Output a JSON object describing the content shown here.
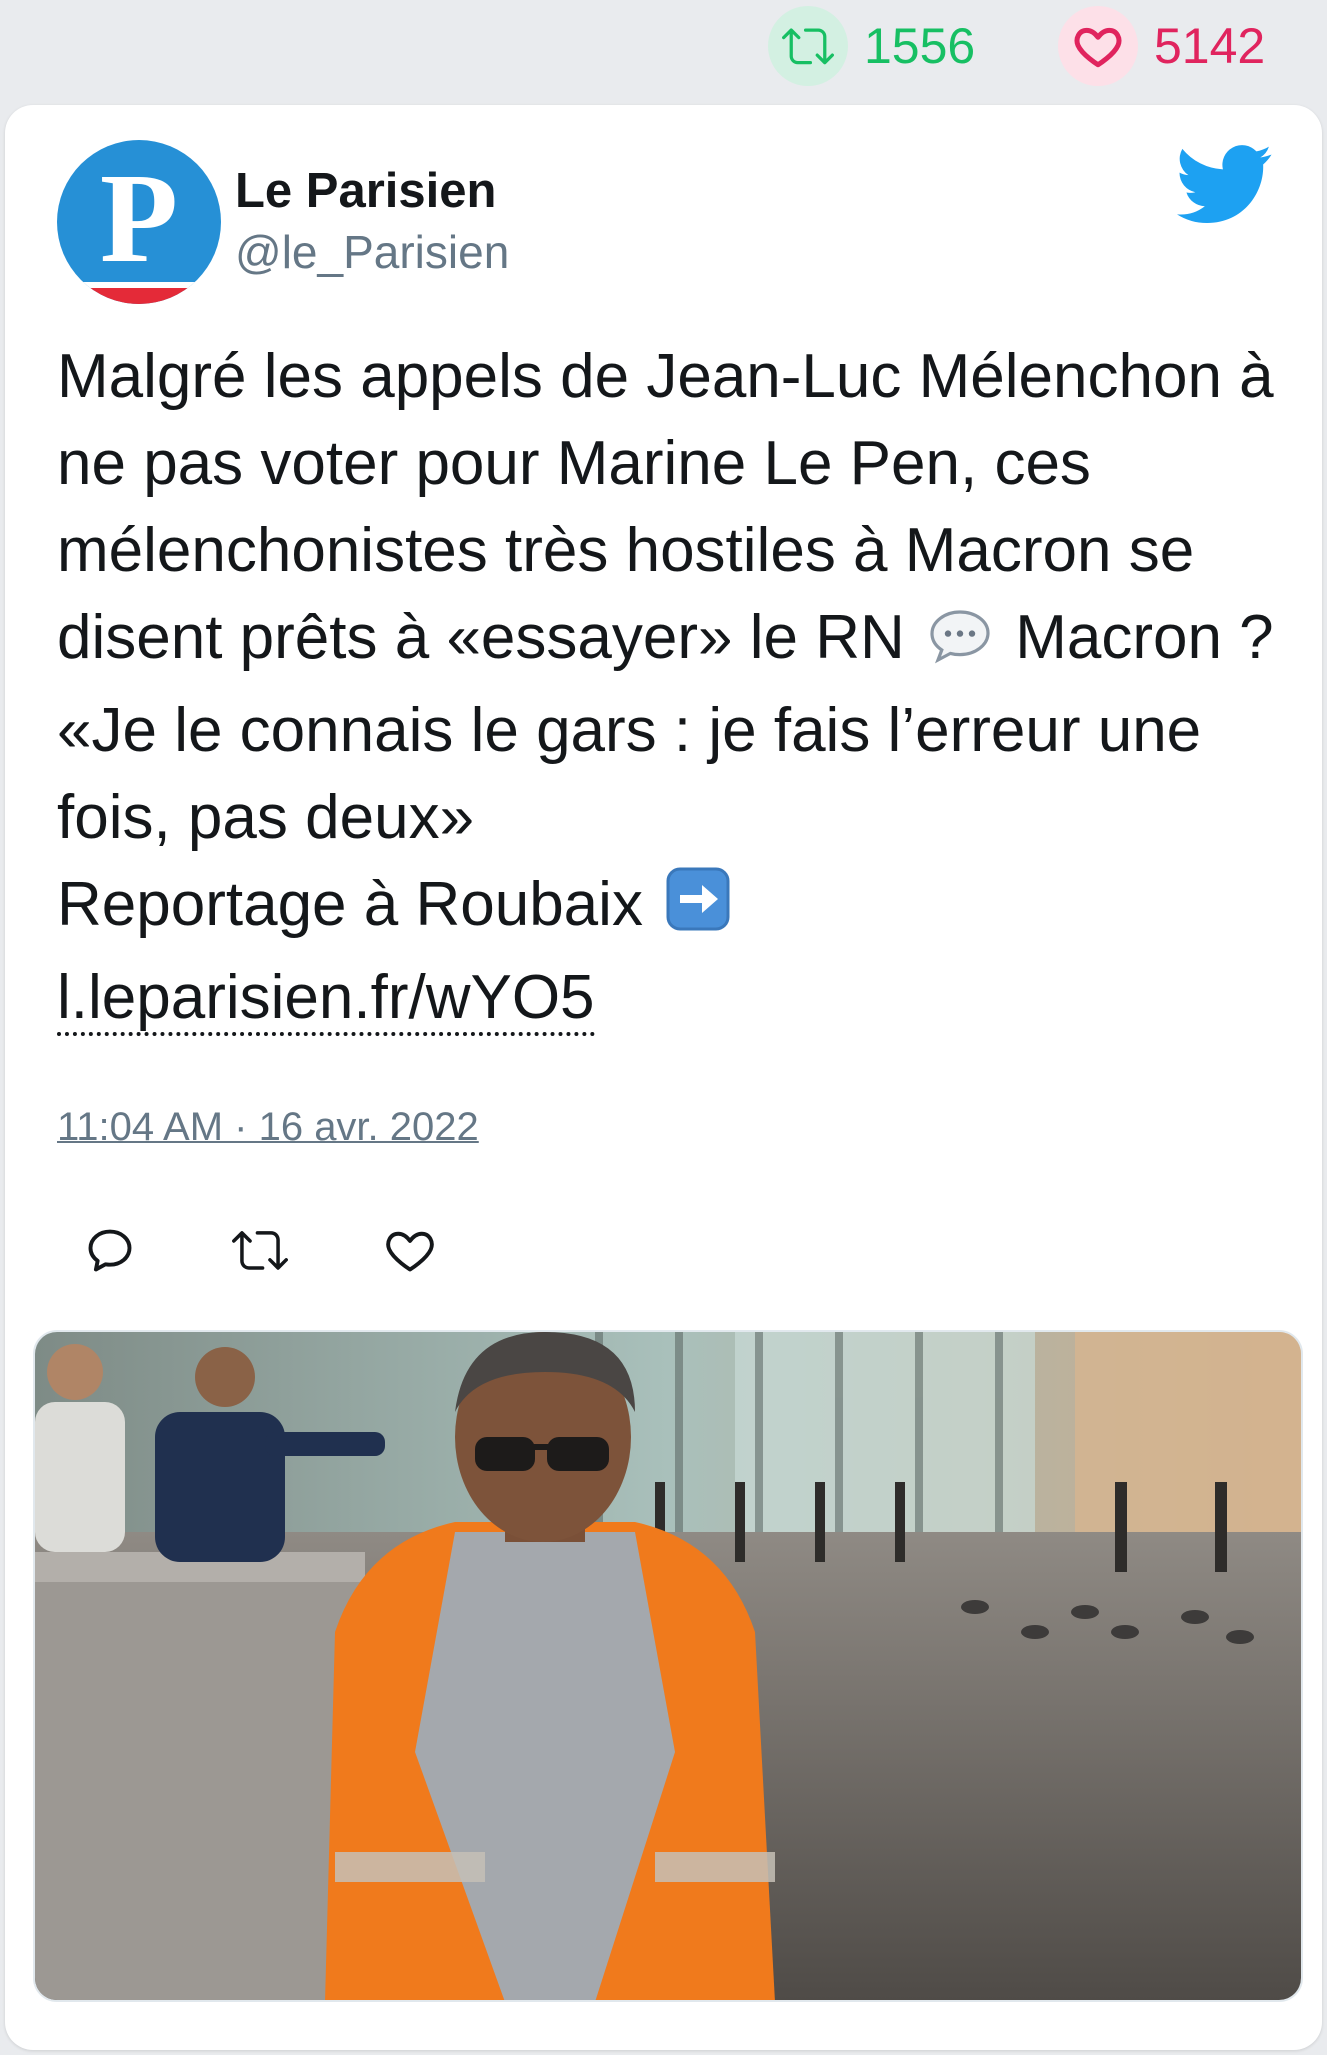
{
  "stats": {
    "retweets": "1556",
    "likes": "5142"
  },
  "author": {
    "avatar_letter": "P",
    "name": "Le Parisien",
    "handle": "@le_Parisien"
  },
  "tweet": {
    "text_part1": "Malgré les appels de Jean-Luc Mélenchon à ne pas voter pour Marine Le Pen, ces mélenchonistes très hostiles à Macron se disent prêts à «essayer» le RN",
    "emoji_speech": "💬",
    "text_part2": "Macron ? «Je le connais le gars : je fais l’erreur une fois, pas deux»",
    "text_part3": "Reportage à Roubaix",
    "emoji_arrow": "➡️",
    "link": "l.leparisien.fr/wYO5",
    "timestamp": "11:04 AM · 16 avr. 2022"
  },
  "icons": {
    "retweet": "retweet-icon",
    "like": "heart-icon",
    "reply": "reply-icon",
    "brand": "twitter-bird-icon"
  },
  "colors": {
    "retweet_green": "#17bf63",
    "like_red": "#e0245e",
    "twitter_blue": "#1da1f2",
    "muted_text": "#657786"
  }
}
